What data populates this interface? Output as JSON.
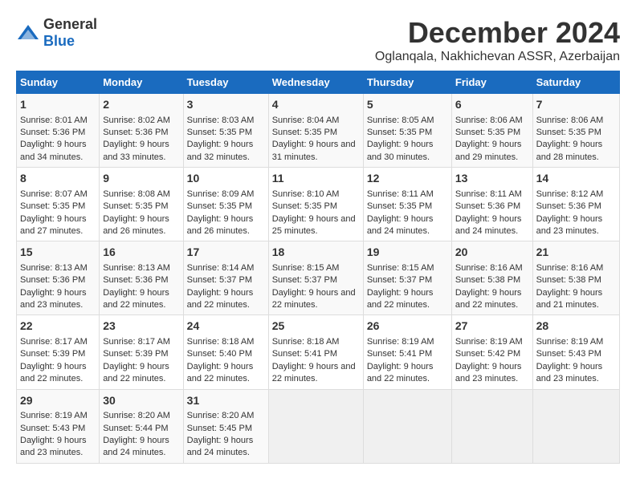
{
  "logo": {
    "text_general": "General",
    "text_blue": "Blue"
  },
  "header": {
    "title": "December 2024",
    "subtitle": "Oglanqala, Nakhichevan ASSR, Azerbaijan"
  },
  "weekdays": [
    "Sunday",
    "Monday",
    "Tuesday",
    "Wednesday",
    "Thursday",
    "Friday",
    "Saturday"
  ],
  "weeks": [
    [
      {
        "day": "1",
        "sunrise": "Sunrise: 8:01 AM",
        "sunset": "Sunset: 5:36 PM",
        "daylight": "Daylight: 9 hours and 34 minutes."
      },
      {
        "day": "2",
        "sunrise": "Sunrise: 8:02 AM",
        "sunset": "Sunset: 5:36 PM",
        "daylight": "Daylight: 9 hours and 33 minutes."
      },
      {
        "day": "3",
        "sunrise": "Sunrise: 8:03 AM",
        "sunset": "Sunset: 5:35 PM",
        "daylight": "Daylight: 9 hours and 32 minutes."
      },
      {
        "day": "4",
        "sunrise": "Sunrise: 8:04 AM",
        "sunset": "Sunset: 5:35 PM",
        "daylight": "Daylight: 9 hours and 31 minutes."
      },
      {
        "day": "5",
        "sunrise": "Sunrise: 8:05 AM",
        "sunset": "Sunset: 5:35 PM",
        "daylight": "Daylight: 9 hours and 30 minutes."
      },
      {
        "day": "6",
        "sunrise": "Sunrise: 8:06 AM",
        "sunset": "Sunset: 5:35 PM",
        "daylight": "Daylight: 9 hours and 29 minutes."
      },
      {
        "day": "7",
        "sunrise": "Sunrise: 8:06 AM",
        "sunset": "Sunset: 5:35 PM",
        "daylight": "Daylight: 9 hours and 28 minutes."
      }
    ],
    [
      {
        "day": "8",
        "sunrise": "Sunrise: 8:07 AM",
        "sunset": "Sunset: 5:35 PM",
        "daylight": "Daylight: 9 hours and 27 minutes."
      },
      {
        "day": "9",
        "sunrise": "Sunrise: 8:08 AM",
        "sunset": "Sunset: 5:35 PM",
        "daylight": "Daylight: 9 hours and 26 minutes."
      },
      {
        "day": "10",
        "sunrise": "Sunrise: 8:09 AM",
        "sunset": "Sunset: 5:35 PM",
        "daylight": "Daylight: 9 hours and 26 minutes."
      },
      {
        "day": "11",
        "sunrise": "Sunrise: 8:10 AM",
        "sunset": "Sunset: 5:35 PM",
        "daylight": "Daylight: 9 hours and 25 minutes."
      },
      {
        "day": "12",
        "sunrise": "Sunrise: 8:11 AM",
        "sunset": "Sunset: 5:35 PM",
        "daylight": "Daylight: 9 hours and 24 minutes."
      },
      {
        "day": "13",
        "sunrise": "Sunrise: 8:11 AM",
        "sunset": "Sunset: 5:36 PM",
        "daylight": "Daylight: 9 hours and 24 minutes."
      },
      {
        "day": "14",
        "sunrise": "Sunrise: 8:12 AM",
        "sunset": "Sunset: 5:36 PM",
        "daylight": "Daylight: 9 hours and 23 minutes."
      }
    ],
    [
      {
        "day": "15",
        "sunrise": "Sunrise: 8:13 AM",
        "sunset": "Sunset: 5:36 PM",
        "daylight": "Daylight: 9 hours and 23 minutes."
      },
      {
        "day": "16",
        "sunrise": "Sunrise: 8:13 AM",
        "sunset": "Sunset: 5:36 PM",
        "daylight": "Daylight: 9 hours and 22 minutes."
      },
      {
        "day": "17",
        "sunrise": "Sunrise: 8:14 AM",
        "sunset": "Sunset: 5:37 PM",
        "daylight": "Daylight: 9 hours and 22 minutes."
      },
      {
        "day": "18",
        "sunrise": "Sunrise: 8:15 AM",
        "sunset": "Sunset: 5:37 PM",
        "daylight": "Daylight: 9 hours and 22 minutes."
      },
      {
        "day": "19",
        "sunrise": "Sunrise: 8:15 AM",
        "sunset": "Sunset: 5:37 PM",
        "daylight": "Daylight: 9 hours and 22 minutes."
      },
      {
        "day": "20",
        "sunrise": "Sunrise: 8:16 AM",
        "sunset": "Sunset: 5:38 PM",
        "daylight": "Daylight: 9 hours and 22 minutes."
      },
      {
        "day": "21",
        "sunrise": "Sunrise: 8:16 AM",
        "sunset": "Sunset: 5:38 PM",
        "daylight": "Daylight: 9 hours and 21 minutes."
      }
    ],
    [
      {
        "day": "22",
        "sunrise": "Sunrise: 8:17 AM",
        "sunset": "Sunset: 5:39 PM",
        "daylight": "Daylight: 9 hours and 22 minutes."
      },
      {
        "day": "23",
        "sunrise": "Sunrise: 8:17 AM",
        "sunset": "Sunset: 5:39 PM",
        "daylight": "Daylight: 9 hours and 22 minutes."
      },
      {
        "day": "24",
        "sunrise": "Sunrise: 8:18 AM",
        "sunset": "Sunset: 5:40 PM",
        "daylight": "Daylight: 9 hours and 22 minutes."
      },
      {
        "day": "25",
        "sunrise": "Sunrise: 8:18 AM",
        "sunset": "Sunset: 5:41 PM",
        "daylight": "Daylight: 9 hours and 22 minutes."
      },
      {
        "day": "26",
        "sunrise": "Sunrise: 8:19 AM",
        "sunset": "Sunset: 5:41 PM",
        "daylight": "Daylight: 9 hours and 22 minutes."
      },
      {
        "day": "27",
        "sunrise": "Sunrise: 8:19 AM",
        "sunset": "Sunset: 5:42 PM",
        "daylight": "Daylight: 9 hours and 23 minutes."
      },
      {
        "day": "28",
        "sunrise": "Sunrise: 8:19 AM",
        "sunset": "Sunset: 5:43 PM",
        "daylight": "Daylight: 9 hours and 23 minutes."
      }
    ],
    [
      {
        "day": "29",
        "sunrise": "Sunrise: 8:19 AM",
        "sunset": "Sunset: 5:43 PM",
        "daylight": "Daylight: 9 hours and 23 minutes."
      },
      {
        "day": "30",
        "sunrise": "Sunrise: 8:20 AM",
        "sunset": "Sunset: 5:44 PM",
        "daylight": "Daylight: 9 hours and 24 minutes."
      },
      {
        "day": "31",
        "sunrise": "Sunrise: 8:20 AM",
        "sunset": "Sunset: 5:45 PM",
        "daylight": "Daylight: 9 hours and 24 minutes."
      },
      null,
      null,
      null,
      null
    ]
  ]
}
